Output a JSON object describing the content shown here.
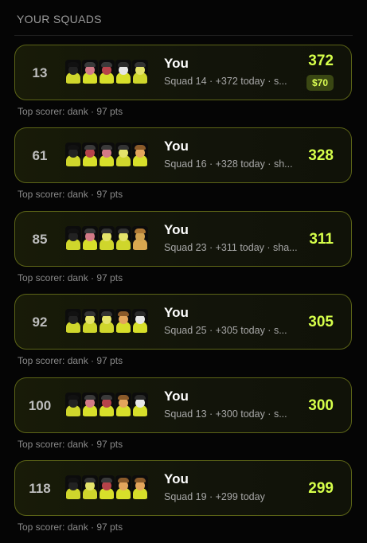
{
  "header": {
    "title": "YOUR SQUADS"
  },
  "palette": {
    "accent": "#d6ff4a",
    "card_border": "#5c6417",
    "background": "#050505"
  },
  "squads": [
    {
      "rank": "13",
      "title": "You",
      "subtitle": "Squad 14 · +372 today · s...",
      "score": "372",
      "prize": "$70",
      "top_scorer": "Top scorer: dank · 97 pts",
      "avatars": [
        {
          "icon": "hooded-skull-avatar-icon",
          "head": "#222222",
          "body": "#cfd62c",
          "hat": "#111111"
        },
        {
          "icon": "pink-mask-avatar-icon",
          "head": "#d27a86",
          "body": "#d7df2a",
          "hat": "#3a3a3a"
        },
        {
          "icon": "red-mask-avatar-icon",
          "head": "#b6434a",
          "body": "#d7df2a",
          "hat": "#3a3a3a"
        },
        {
          "icon": "skull-avatar-icon",
          "head": "#e6e6e6",
          "body": "#d7df2a",
          "hat": "#2a2a2a"
        },
        {
          "icon": "yellow-hood-avatar-icon",
          "head": "#e4e36a",
          "body": "#cfd62c",
          "hat": "#333333"
        }
      ]
    },
    {
      "rank": "61",
      "title": "You",
      "subtitle": "Squad 16 · +328 today · sh...",
      "score": "328",
      "prize": "",
      "top_scorer": "Top scorer: dank · 97 pts",
      "avatars": [
        {
          "icon": "hooded-skull-avatar-icon",
          "head": "#222222",
          "body": "#cfd62c",
          "hat": "#111111"
        },
        {
          "icon": "red-mask-avatar-icon",
          "head": "#b6434a",
          "body": "#d7df2a",
          "hat": "#3a3a3a"
        },
        {
          "icon": "pink-mask-avatar-icon",
          "head": "#d27a86",
          "body": "#d7df2a",
          "hat": "#3a3a3a"
        },
        {
          "icon": "yellow-hood-avatar-icon",
          "head": "#e4e36a",
          "body": "#cfd62c",
          "hat": "#333333"
        },
        {
          "icon": "bread-head-avatar-icon",
          "head": "#e3a55c",
          "body": "#d7df2a",
          "hat": "#8a5a2a"
        }
      ]
    },
    {
      "rank": "85",
      "title": "You",
      "subtitle": "Squad 23 · +311 today · sha...",
      "score": "311",
      "prize": "",
      "top_scorer": "Top scorer: dank · 97 pts",
      "avatars": [
        {
          "icon": "hooded-skull-avatar-icon",
          "head": "#222222",
          "body": "#cfd62c",
          "hat": "#111111"
        },
        {
          "icon": "pink-mask-avatar-icon",
          "head": "#d27a86",
          "body": "#d7df2a",
          "hat": "#3a3a3a"
        },
        {
          "icon": "yellow-hood-avatar-icon",
          "head": "#e4e36a",
          "body": "#cfd62c",
          "hat": "#333333"
        },
        {
          "icon": "yellow-hood-avatar-icon",
          "head": "#e4e36a",
          "body": "#cfd62c",
          "hat": "#333333"
        },
        {
          "icon": "cat-avatar-icon",
          "head": "#d1a24f",
          "body": "#d9a74f",
          "hat": "#b07a35"
        }
      ]
    },
    {
      "rank": "92",
      "title": "You",
      "subtitle": "Squad 25 · +305 today · s...",
      "score": "305",
      "prize": "",
      "top_scorer": "Top scorer: dank · 97 pts",
      "avatars": [
        {
          "icon": "hooded-skull-avatar-icon",
          "head": "#222222",
          "body": "#cfd62c",
          "hat": "#111111"
        },
        {
          "icon": "yellow-hood-avatar-icon",
          "head": "#e4e36a",
          "body": "#cfd62c",
          "hat": "#333333"
        },
        {
          "icon": "yellow-hood-avatar-icon",
          "head": "#e4e36a",
          "body": "#cfd62c",
          "hat": "#333333"
        },
        {
          "icon": "bread-head-avatar-icon",
          "head": "#e3a55c",
          "body": "#d7df2a",
          "hat": "#8a5a2a"
        },
        {
          "icon": "skull-avatar-icon",
          "head": "#e6e6e6",
          "body": "#d7df2a",
          "hat": "#2a2a2a"
        }
      ]
    },
    {
      "rank": "100",
      "title": "You",
      "subtitle": "Squad 13 · +300 today · s...",
      "score": "300",
      "prize": "",
      "top_scorer": "Top scorer: dank · 97 pts",
      "avatars": [
        {
          "icon": "hooded-skull-avatar-icon",
          "head": "#222222",
          "body": "#cfd62c",
          "hat": "#111111"
        },
        {
          "icon": "pink-mask-avatar-icon",
          "head": "#d27a86",
          "body": "#d7df2a",
          "hat": "#3a3a3a"
        },
        {
          "icon": "red-mask-avatar-icon",
          "head": "#b6434a",
          "body": "#d7df2a",
          "hat": "#3a3a3a"
        },
        {
          "icon": "bread-head-avatar-icon",
          "head": "#e3a55c",
          "body": "#d7df2a",
          "hat": "#8a5a2a"
        },
        {
          "icon": "skull-avatar-icon",
          "head": "#e6e6e6",
          "body": "#d7df2a",
          "hat": "#2a2a2a"
        }
      ]
    },
    {
      "rank": "118",
      "title": "You",
      "subtitle": "Squad 19 · +299 today",
      "score": "299",
      "prize": "",
      "top_scorer": "Top scorer: dank · 97 pts",
      "avatars": [
        {
          "icon": "hooded-skull-avatar-icon",
          "head": "#222222",
          "body": "#cfd62c",
          "hat": "#111111"
        },
        {
          "icon": "yellow-hood-avatar-icon",
          "head": "#e4e36a",
          "body": "#cfd62c",
          "hat": "#333333"
        },
        {
          "icon": "red-mask-avatar-icon",
          "head": "#b6434a",
          "body": "#d7df2a",
          "hat": "#3a3a3a"
        },
        {
          "icon": "bread-head-avatar-icon",
          "head": "#e3a55c",
          "body": "#d7df2a",
          "hat": "#8a5a2a"
        },
        {
          "icon": "bread-head-avatar-icon",
          "head": "#e3a55c",
          "body": "#d7df2a",
          "hat": "#8a5a2a"
        }
      ]
    }
  ]
}
